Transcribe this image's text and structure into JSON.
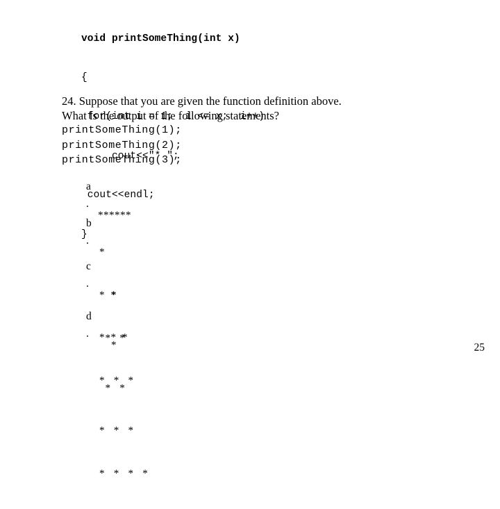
{
  "slide": {
    "page_number": "25",
    "background_color": "#ffffff",
    "text_color": "#000000"
  },
  "code": {
    "lines": [
      "void printSomeThing(int x)",
      "{",
      " for(int i = 1;  i <= x;  i++)",
      "     cout<<\"* \";",
      " cout<<endl;",
      "}"
    ]
  },
  "question": {
    "prose": [
      "24. Suppose that you are given the function definition above.",
      "What is the output of the following statements?"
    ],
    "calls": [
      "printSomeThing(1);",
      "printSomeThing(2);",
      "printSomeThing(3);"
    ]
  },
  "choices": [
    {
      "letter": "a",
      "dot": ".",
      "rows": [
        "******"
      ]
    },
    {
      "letter": "b",
      "dot": ".",
      "rows": [
        "*",
        "*  *",
        "*  *  *"
      ]
    },
    {
      "letter": "c",
      "dot": ".",
      "rows": [
        "    *",
        "  *   *",
        "*   *   *"
      ]
    },
    {
      "letter": "d",
      "dot": ".",
      "rows": [
        "    *",
        "  *   *",
        "*   *   *",
        "*   *   *   *"
      ]
    }
  ]
}
